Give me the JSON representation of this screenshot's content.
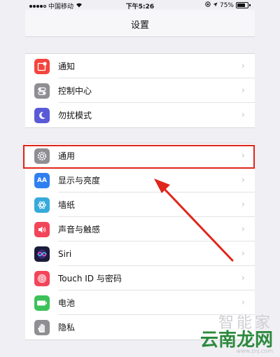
{
  "status_bar": {
    "carrier": "中国移动",
    "time": "下午5:26",
    "battery": "75%"
  },
  "nav": {
    "title": "设置"
  },
  "groups": [
    {
      "items": [
        {
          "label": "通知",
          "icon": "notifications-icon",
          "color": "#f2453d"
        },
        {
          "label": "控制中心",
          "icon": "control-center-icon",
          "color": "#8e8e93"
        },
        {
          "label": "勿扰模式",
          "icon": "moon-icon",
          "color": "#5a5ad8"
        }
      ]
    },
    {
      "items": [
        {
          "label": "通用",
          "icon": "gear-icon",
          "color": "#8e8e93"
        },
        {
          "label": "显示与亮度",
          "icon": "display-icon",
          "color": "#2f7ff0",
          "icon_text": "AA"
        },
        {
          "label": "墙纸",
          "icon": "wallpaper-icon",
          "color": "#36aadc"
        },
        {
          "label": "声音与触感",
          "icon": "sound-icon",
          "color": "#f2455a"
        },
        {
          "label": "Siri",
          "icon": "siri-icon",
          "color": "#1b1b3a"
        },
        {
          "label": "Touch ID 与密码",
          "icon": "fingerprint-icon",
          "color": "#f2455a"
        },
        {
          "label": "电池",
          "icon": "battery-icon",
          "color": "#3cc25a"
        },
        {
          "label": "隐私",
          "icon": "hand-icon",
          "color": "#8e8e93"
        }
      ]
    }
  ],
  "annotation": {
    "highlight_color": "#e0261b",
    "highlighted_item": "通用"
  },
  "watermark": {
    "top": "智能家",
    "main": "云南龙网",
    "url": "www.znj.com"
  }
}
